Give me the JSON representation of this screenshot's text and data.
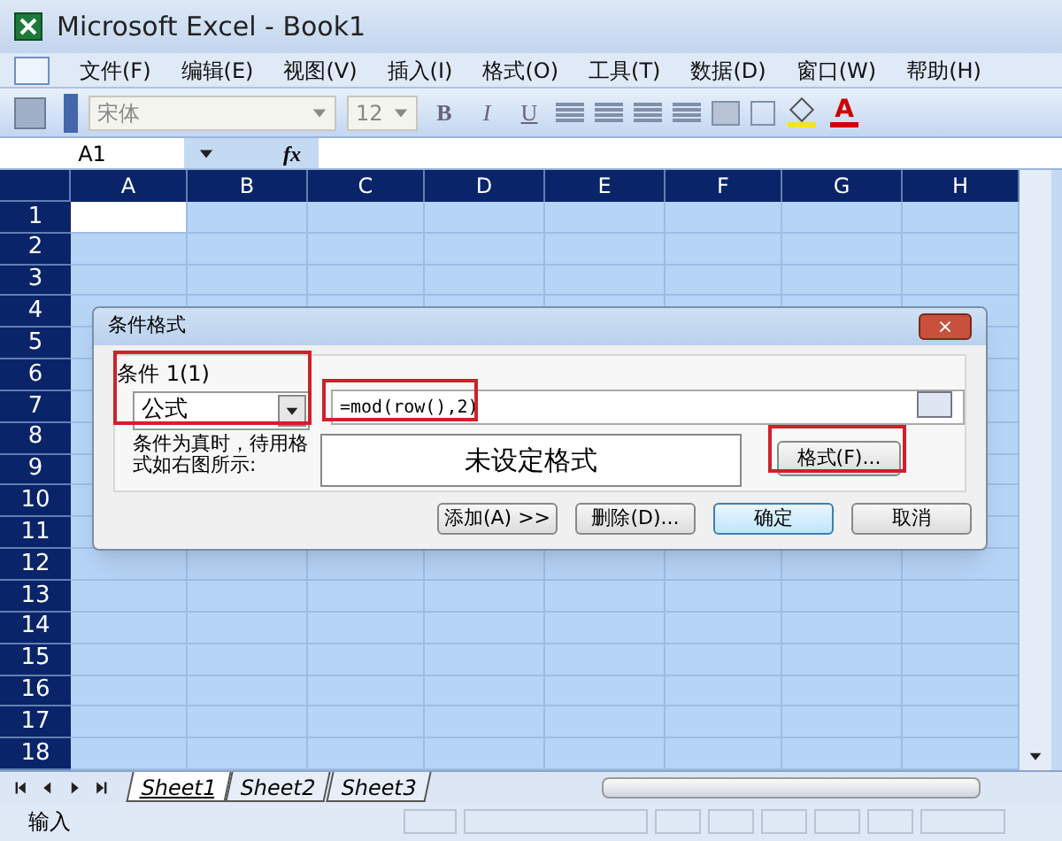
{
  "window": {
    "title": "Microsoft Excel - Book1"
  },
  "menu": [
    "文件(F)",
    "编辑(E)",
    "视图(V)",
    "插入(I)",
    "格式(O)",
    "工具(T)",
    "数据(D)",
    "窗口(W)",
    "帮助(H)"
  ],
  "toolbar": {
    "font": "宋体",
    "size": "12",
    "bold": "B",
    "italic": "I",
    "underline": "U",
    "font_color": "A"
  },
  "formula_bar": {
    "name_box": "A1",
    "fx": "fx"
  },
  "sheet": {
    "columns": [
      "A",
      "B",
      "C",
      "D",
      "E",
      "F",
      "G",
      "H"
    ],
    "rows": [
      "1",
      "2",
      "3",
      "4",
      "5",
      "6",
      "7",
      "8",
      "9",
      "10",
      "11",
      "12",
      "13",
      "14",
      "15",
      "16",
      "17",
      "18"
    ],
    "all_selected": true
  },
  "dialog": {
    "title": "条件格式",
    "close": "×",
    "condition_label": "条件 1(1)",
    "condition_type": "公式",
    "formula": "=mod(row(),2)",
    "preview_label": "条件为真时，待用格式如右图所示:",
    "preview": "未设定格式",
    "format_button": "格式(F)...",
    "highlights": {
      "condition": true,
      "formula": true,
      "format_button": true
    },
    "buttons": [
      {
        "label": "添加(A) >>",
        "default": false
      },
      {
        "label": "删除(D)...",
        "default": false
      },
      {
        "label": "确定",
        "default": true
      },
      {
        "label": "取消",
        "default": false
      }
    ]
  },
  "sheet_tabs": [
    {
      "label": "Sheet1",
      "selected": true
    },
    {
      "label": "Sheet2",
      "selected": false
    },
    {
      "label": "Sheet3",
      "selected": false
    }
  ],
  "status_bar": {
    "text": "输入"
  }
}
